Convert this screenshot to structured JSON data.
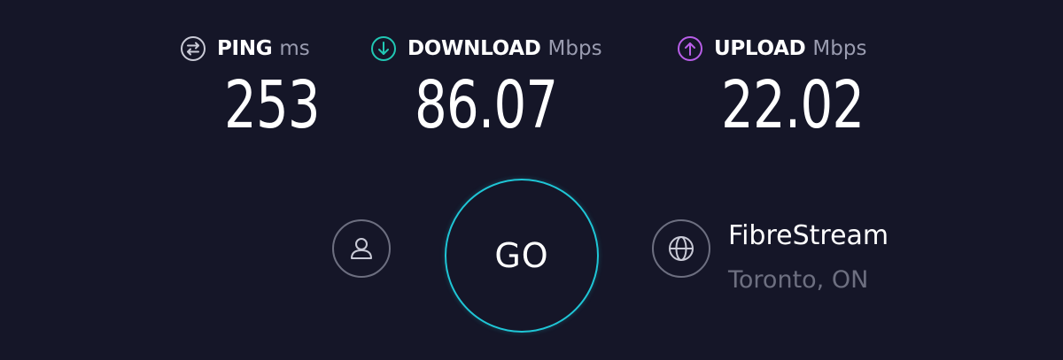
{
  "metrics": {
    "ping": {
      "label": "PING",
      "unit": "ms",
      "value": "253",
      "icon": "ping-icon",
      "color": "#c9cad6"
    },
    "download": {
      "label": "DOWNLOAD",
      "unit": "Mbps",
      "value": "86.07",
      "icon": "download-arrow-icon",
      "color": "#21c8b4"
    },
    "upload": {
      "label": "UPLOAD",
      "unit": "Mbps",
      "value": "22.02",
      "icon": "upload-arrow-icon",
      "color": "#b85ee8"
    }
  },
  "go_button": {
    "label": "GO",
    "color": "#1fc6d6"
  },
  "user_button": {
    "icon": "user-icon"
  },
  "server": {
    "icon": "globe-icon",
    "provider": "FibreStream",
    "location": "Toronto, ON"
  },
  "colors": {
    "background": "#151628",
    "text": "#ffffff",
    "muted": "#6d6f80"
  }
}
